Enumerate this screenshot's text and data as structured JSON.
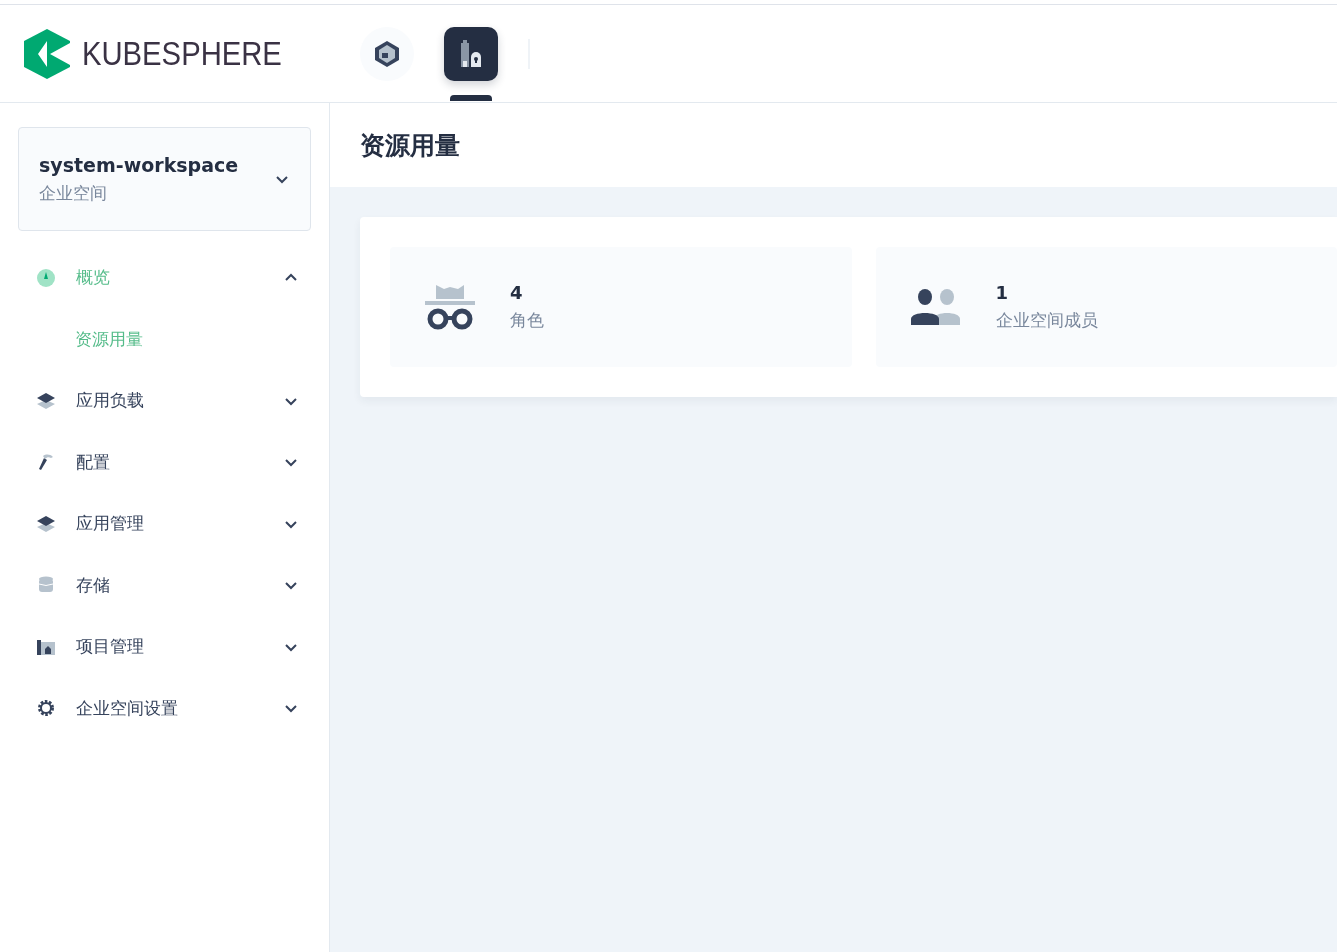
{
  "header": {
    "logo": "KUBESPHERE",
    "nav": [
      {
        "kind": "platform",
        "selected": false
      },
      {
        "kind": "workspace",
        "selected": true
      }
    ]
  },
  "workspace": {
    "name": "system-workspace",
    "type": "企业空间"
  },
  "sidebar": {
    "items": [
      {
        "label": "概览",
        "kind": "gauge",
        "selected": true,
        "expanded": true,
        "children": [
          {
            "label": "资源用量",
            "selected": true
          }
        ]
      },
      {
        "label": "应用负载",
        "kind": "layers",
        "selected": false,
        "expanded": false
      },
      {
        "label": "配置",
        "kind": "hammer",
        "selected": false,
        "expanded": false
      },
      {
        "label": "应用管理",
        "kind": "layers",
        "selected": false,
        "expanded": false
      },
      {
        "label": "存储",
        "kind": "database",
        "selected": false,
        "expanded": false
      },
      {
        "label": "项目管理",
        "kind": "project",
        "selected": false,
        "expanded": false
      },
      {
        "label": "企业空间设置",
        "kind": "gear",
        "selected": false,
        "expanded": false
      }
    ]
  },
  "page": {
    "title": "资源用量"
  },
  "stats": [
    {
      "kind": "role",
      "value": "4",
      "label": "角色"
    },
    {
      "kind": "members",
      "value": "1",
      "label": "企业空间成员"
    }
  ]
}
